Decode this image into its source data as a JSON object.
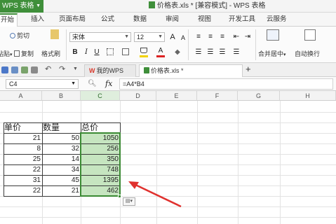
{
  "titlebar": {
    "app_label": "WPS 表格",
    "document_title": "价格表.xls * [兼容模式] - WPS 表格"
  },
  "menu": {
    "tabs": [
      "开始",
      "插入",
      "页面布局",
      "公式",
      "数据",
      "审阅",
      "视图",
      "开发工具",
      "云服务"
    ],
    "active_tab": "开始"
  },
  "ribbon": {
    "cut_label": "剪切",
    "copy_label": "复制",
    "format_painter_label": "格式刷",
    "paste_label": "粘贴",
    "font_name": "宋体",
    "font_size": "12",
    "merge_center_label": "合并居中",
    "wrap_text_label": "自动换行"
  },
  "doc_tabs": [
    {
      "label": "我的WPS",
      "active": false
    },
    {
      "label": "价格表.xls *",
      "active": true
    }
  ],
  "formula_bar": {
    "name_box": "C4",
    "fx_label": "fx",
    "formula": "=A4*B4"
  },
  "sheet": {
    "columns": [
      "A",
      "B",
      "C",
      "D",
      "E",
      "F",
      "G",
      "H"
    ],
    "selected_column": "C",
    "headers": [
      "单价",
      "数量",
      "总价"
    ],
    "rows": [
      [
        "21",
        "50",
        "1050"
      ],
      [
        "8",
        "32",
        "256"
      ],
      [
        "25",
        "14",
        "350"
      ],
      [
        "22",
        "34",
        "748"
      ],
      [
        "31",
        "45",
        "1395"
      ],
      [
        "22",
        "21",
        "462"
      ]
    ]
  },
  "colors": {
    "accent": "#3f8f3a",
    "selection_fill": "#c6e5c0",
    "arrow": "#e0312e"
  }
}
